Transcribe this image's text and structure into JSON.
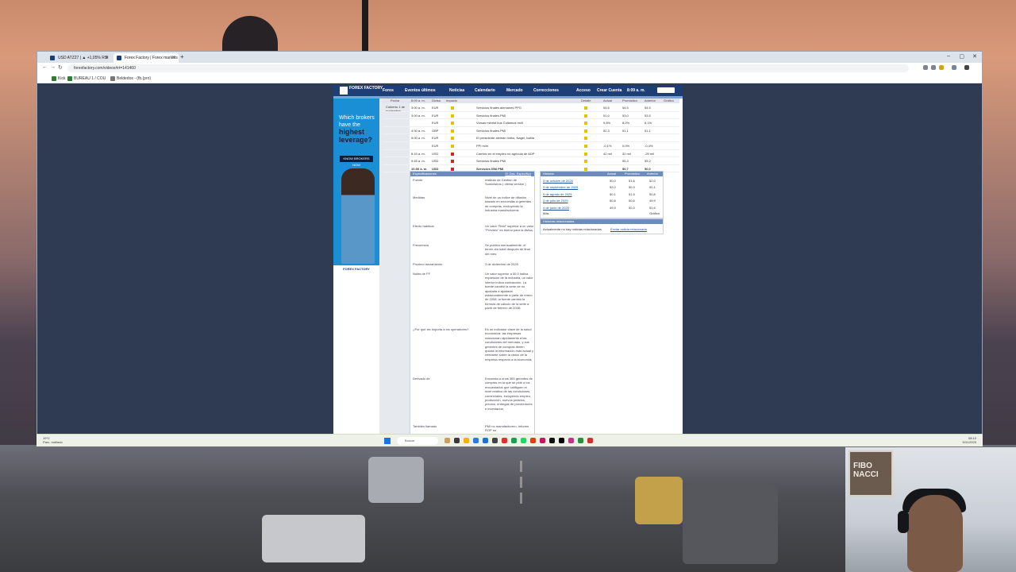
{
  "browser": {
    "tabs": [
      {
        "title": "USD ATZ27 | ▲ +1,05% RSI",
        "active": false
      },
      {
        "title": "Forex Factory | Forex markets f",
        "active": true
      }
    ],
    "url": "forexfactory.com/videos#rt=141460",
    "bookmarks": [
      "Kick",
      "BUREAU 1 / COU",
      "Beldedos - (fb.(pro)"
    ]
  },
  "forexfactory": {
    "nav": [
      "Foros",
      "Eventos últimos",
      "Noticias",
      "Calendario",
      "Mercado",
      "Correcciones",
      "Acceso",
      "Crear Cuenta",
      "8:09 a. m."
    ],
    "logo": "FOREX FACTORY",
    "ad": {
      "line1": "Which brokers have the",
      "emphasis": "highest leverage?",
      "button": "KNOW BROKERS NOW",
      "footer": "FOREX FACTORY"
    },
    "calendar": {
      "columns": [
        "Fecha",
        "8:09 a. m.",
        "Divisa",
        "Impacto",
        "",
        "Detalle",
        "Actual",
        "Pronóstico",
        "Anterior",
        "Gráfico"
      ],
      "date_label": "Cubierto 1 de noviembre",
      "rows": [
        {
          "time": "3:00 a. m.",
          "cur": "EUR",
          "event": "Servicios finales alemanes PPG",
          "actual": "54,6",
          "forecast": "54,5",
          "previous": "54,5"
        },
        {
          "time": "3:00 a. m.",
          "cur": "EUR",
          "event": "Servicios finales PMI",
          "actual": "51,0",
          "forecast": "53,0",
          "previous": "53,5"
        },
        {
          "time": "",
          "cur": "EUR",
          "event": "Vorsas minrist bus Cullamos nn/ti",
          "actual": "9,8%",
          "forecast": "8,2%",
          "previous": "8,1%"
        },
        {
          "time": "4:30 a. m.",
          "cur": "GBP",
          "event": "Servicios finales PMI",
          "actual": "52,3",
          "forecast": "51,1",
          "previous": "51,1"
        },
        {
          "time": "5:00 a. m.",
          "cur": "EUR",
          "event": "El presidente alemán Volks, Nagel, habla",
          "actual": "",
          "forecast": "",
          "previous": ""
        },
        {
          "time": "",
          "cur": "EUR",
          "event": "PPI m/m",
          "actual": "-0,1%",
          "forecast": "0,0%",
          "previous": "-0,4%"
        },
        {
          "time": "8:15 a. m.",
          "cur": "USD",
          "event": "Cambio en el empleo no agrícola de ADP",
          "actual": "42 mil",
          "forecast": "32 mil",
          "previous": "-29 mil"
        },
        {
          "time": "9:45 a. m.",
          "cur": "USD",
          "event": "Servicios finales PMI",
          "actual": "",
          "forecast": "55,3",
          "previous": "55,2"
        },
        {
          "time": "10:00 a. m.",
          "cur": "USD",
          "event": "Servicios ISM PMI",
          "actual": "",
          "forecast": "50,7",
          "previous": "50,0"
        }
      ]
    },
    "specs": {
      "header": "Especificaciones",
      "header_link": "El Gas. Especifico",
      "items": [
        {
          "k": "Fuente",
          "v": "Instituto de Gestión de Suministros ( última versión )"
        },
        {
          "k": "Medidas",
          "v": "Nivel de un índice de difusión basado en encuestas a gerentes de compras, excluyendo la industria manufacturera;"
        },
        {
          "k": "Efecto habitual",
          "v": "Un valor \"Real\" superior a un valor \"Previsto\" es bueno para la divisa;"
        },
        {
          "k": "Frecuencia",
          "v": "Se publica mensualmente, el tercer día hábil después de final del mes;"
        },
        {
          "k": "Próximo lanzamiento",
          "v": "3 de diciembre de 2025"
        },
        {
          "k": "Notas de FF",
          "v": "Un valor superior a 50,0 indica expansión de la industria, un valor inferior indica contracción. La fuente cambió la serie de no ajustada a ajustada estacionalmente a partir de enero de 2008; la fuente cambió la fórmula de cálculo de la serie a partir de febrero de 2008;"
        },
        {
          "k": "¿Por qué les importa a los operadores?",
          "v": "Es un indicador clave de la salud económica: las empresas reaccionan rápidamente a las condiciones del mercado, y sus gerentes de compras tienen quizás la información más actual y relevante sobre la visión de la empresa respecto a la economía;"
        },
        {
          "k": "Derivado de",
          "v": "Encuesta a unos 365 gerentes de compras en la que se pide a los encuestados que califiquen el nivel relativo de las condiciones comerciales, incluyendo empleo, producción, nuevos pedidos, precios, entregas de proveedores e inventarios;"
        },
        {
          "k": "También llamado",
          "v": "PMI no manufacturero, Informe ROP no"
        }
      ]
    },
    "history": {
      "header": "Historia",
      "columns": [
        "Actual",
        "Pronóstico",
        "Anterior"
      ],
      "rows": [
        {
          "date": "3 de octubre de 2025",
          "actual": "50,0",
          "forecast": "51,6",
          "previous": "52,0"
        },
        {
          "date": "3 de septiembre de 2025",
          "actual": "52,0",
          "forecast": "50,9",
          "previous": "50,1"
        },
        {
          "date": "5 de agosto de 2025",
          "actual": "50,1",
          "forecast": "51,5",
          "previous": "50,8"
        },
        {
          "date": "3 de julio de 2025",
          "actual": "50,8",
          "forecast": "50,6",
          "previous": "49,9"
        },
        {
          "date": "4 de junio de 2025",
          "actual": "49,9",
          "forecast": "52,0",
          "previous": "51,6"
        }
      ],
      "more": "Más",
      "graph": "Gráfico"
    },
    "related": {
      "header": "Historias relacionadas",
      "text": "Actualmente no hay noticias relacionadas.",
      "link": "Enviar noticia relacionada"
    }
  },
  "taskbar": {
    "weather_temp": "19°C",
    "weather_desc": "Parc. nublado",
    "search_placeholder": "Buscar",
    "time": "08:10",
    "date": "5/11/2025"
  },
  "webcam": {
    "sign_text": "FIBO NACCI"
  }
}
